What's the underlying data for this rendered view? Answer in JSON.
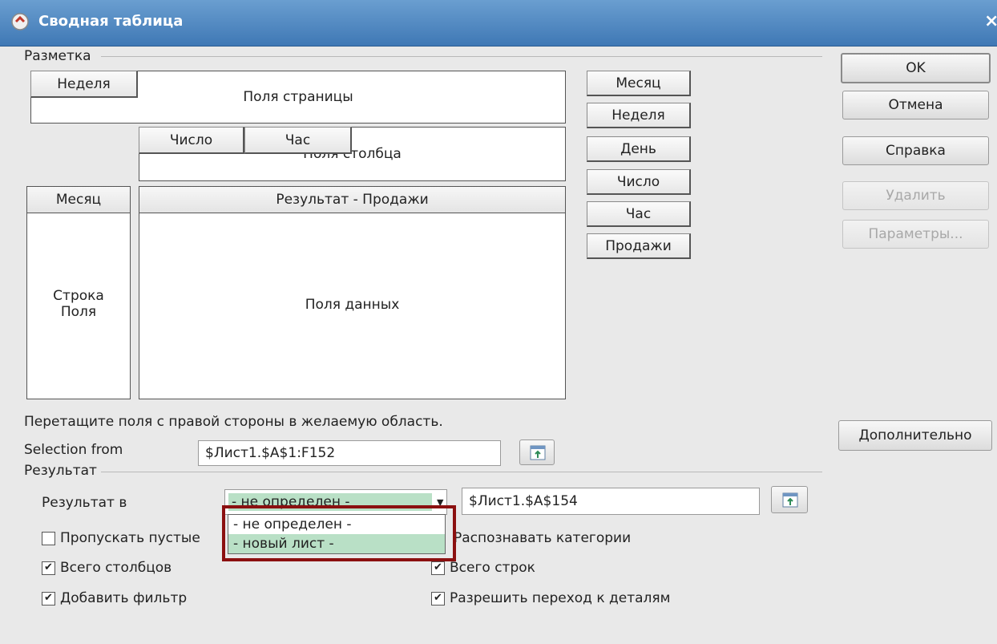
{
  "window": {
    "title": "Сводная таблица",
    "close": "×"
  },
  "layout": {
    "group_label": "Разметка",
    "page_fields": {
      "label": "Поля страницы",
      "placed": [
        "Неделя"
      ]
    },
    "column_fields": {
      "label": "Поля столбца",
      "placed": [
        "Число",
        "Час"
      ]
    },
    "row_fields": {
      "label": "Строка Поля",
      "placed": [
        "Месяц"
      ]
    },
    "data_fields": {
      "label": "Поля данных",
      "placed": [
        "Результат - Продажи"
      ]
    },
    "available_fields": [
      "Месяц",
      "Неделя",
      "День",
      "Число",
      "Час",
      "Продажи"
    ],
    "hint": "Перетащите поля с правой стороны в желаемую область."
  },
  "selection": {
    "label": "Selection from",
    "value": "$Лист1.$A$1:F152"
  },
  "result": {
    "group_label": "Результат",
    "output_label": "Результат в",
    "output_selected": "- не определен -",
    "output_options": [
      "- не определен -",
      "- новый лист -"
    ],
    "output_ref": "$Лист1.$A$154"
  },
  "options": [
    {
      "label": "Пропускать пустые строки",
      "visible_label": "Пропускать пустые",
      "checked": false
    },
    {
      "label": "Распознавать категории",
      "visible_label": "Распознавать категории",
      "checked": false
    },
    {
      "label": "Всего столбцов",
      "checked": true
    },
    {
      "label": "Всего строк",
      "checked": true
    },
    {
      "label": "Добавить фильтр",
      "checked": true
    },
    {
      "label": "Разрешить переход к деталям",
      "checked": true
    }
  ],
  "buttons": {
    "ok": "OK",
    "cancel": "Отмена",
    "help": "Справка",
    "remove": "Удалить",
    "options": "Параметры...",
    "more": "Дополнительно"
  },
  "colors": {
    "title_bar": "#4a82bf",
    "highlight_frame": "#8b1010",
    "selected_item": "#b9e0c6"
  }
}
